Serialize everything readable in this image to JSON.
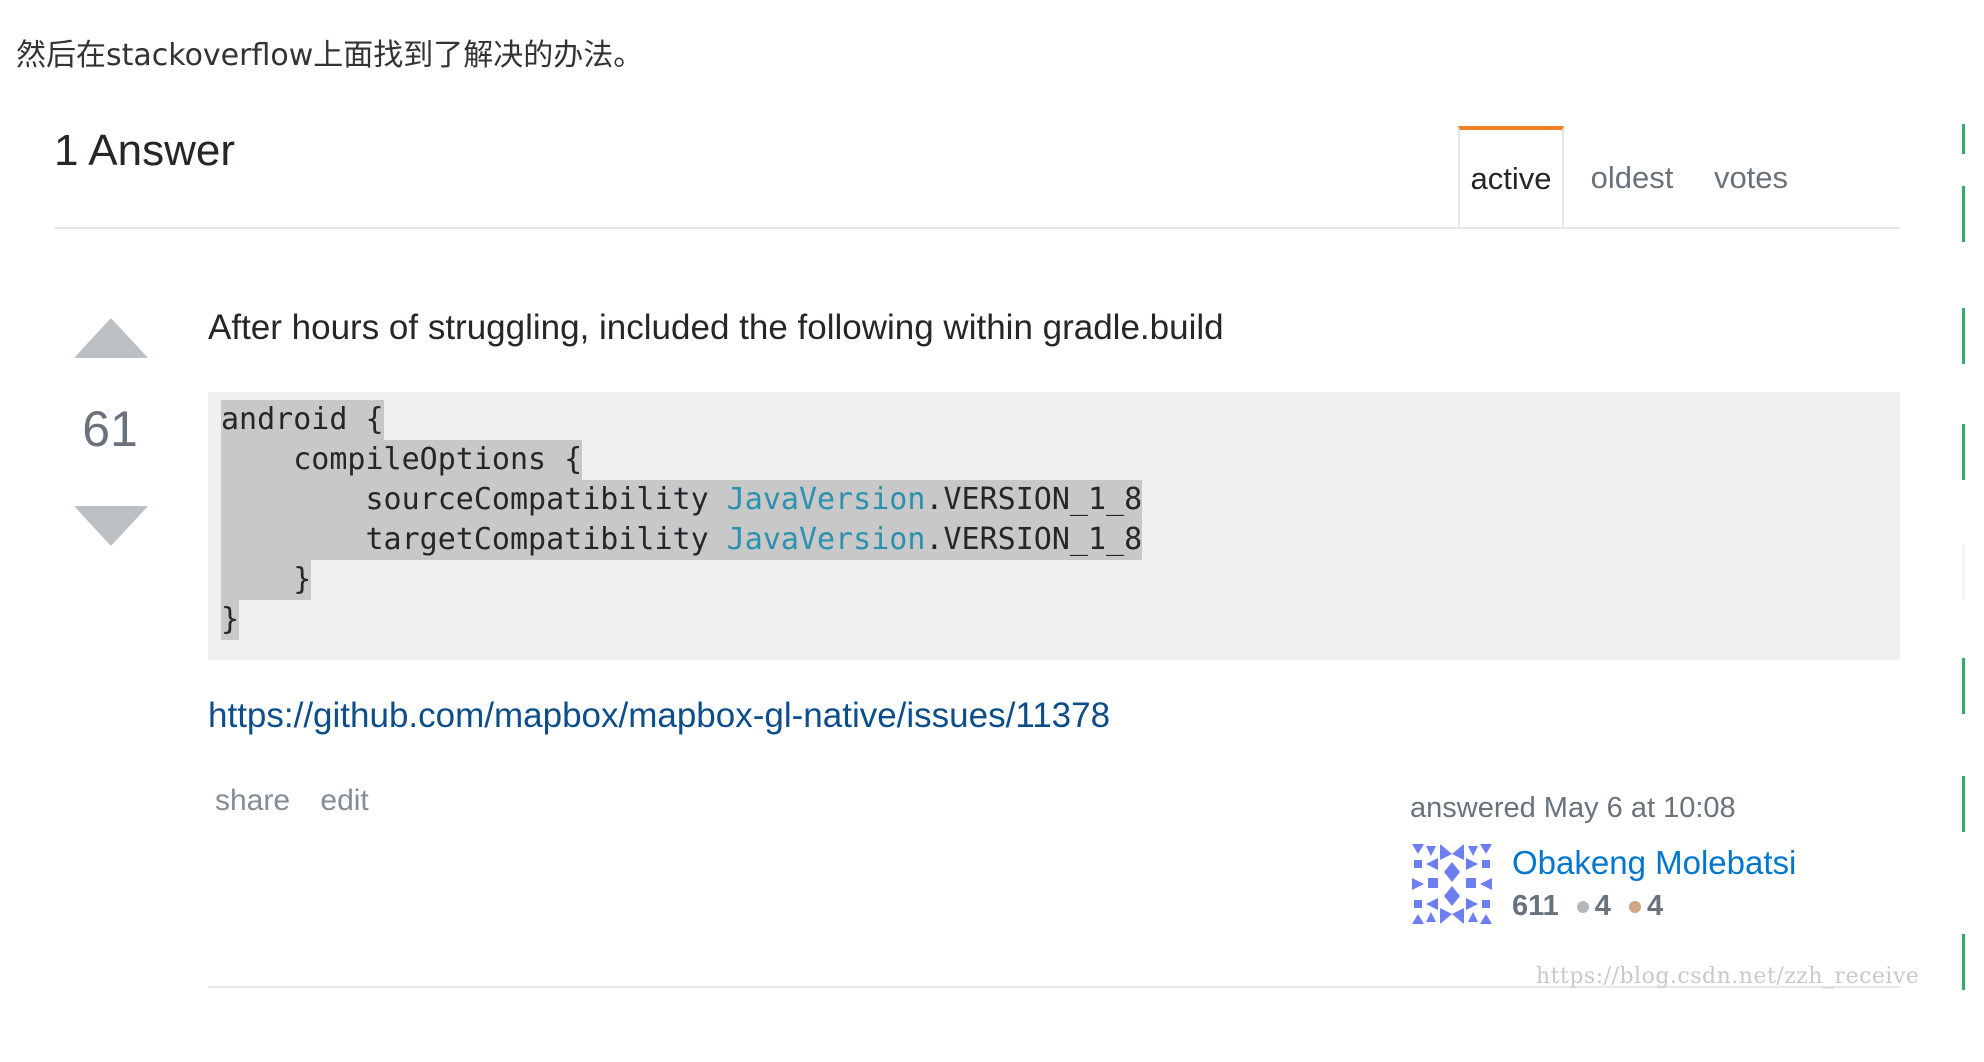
{
  "intro_text": "然后在stackoverflow上面找到了解决的办法。",
  "answers_header": "1 Answer",
  "sort_tabs": [
    {
      "label": "active",
      "selected": true
    },
    {
      "label": "oldest",
      "selected": false
    },
    {
      "label": "votes",
      "selected": false
    }
  ],
  "vote": {
    "count": "61"
  },
  "answer": {
    "text": "After hours of struggling, included the following within gradle.build",
    "code_lines": [
      {
        "plain": "android {"
      },
      {
        "plain": "    compileOptions {"
      },
      {
        "pre": "        sourceCompatibility ",
        "type": "JavaVersion",
        "post": ".VERSION_1_8"
      },
      {
        "pre": "        targetCompatibility ",
        "type": "JavaVersion",
        "post": ".VERSION_1_8"
      },
      {
        "plain": "    }"
      },
      {
        "plain": "}"
      }
    ],
    "link": "https://github.com/mapbox/mapbox-gl-native/issues/11378"
  },
  "post_menu": {
    "share": "share",
    "edit": "edit"
  },
  "user_info": {
    "action_time": "answered May 6 at 10:08",
    "name": "Obakeng Molebatsi",
    "reputation": "611",
    "silver_badges": "4",
    "bronze_badges": "4"
  },
  "watermark": "https://blog.csdn.net/zzh_receive",
  "colors": {
    "accent_tab": "#f48024",
    "link": "#0c4d8a",
    "user_link": "#0077cc",
    "code_type": "#2b91af",
    "right_bar": "#39a96b"
  }
}
